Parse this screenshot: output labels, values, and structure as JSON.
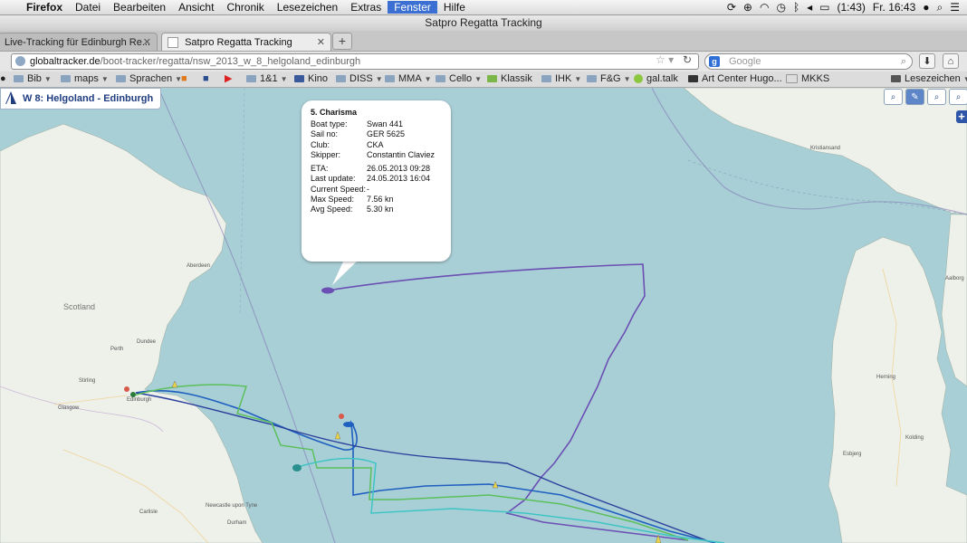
{
  "menubar": {
    "app": "Firefox",
    "items": [
      "Datei",
      "Bearbeiten",
      "Ansicht",
      "Chronik",
      "Lesezeichen",
      "Extras",
      "Fenster",
      "Hilfe"
    ],
    "battery": "(1:43)",
    "clock": "Fr. 16:43"
  },
  "window": {
    "title": "Satpro Regatta Tracking"
  },
  "tabs": [
    {
      "label": "Live-Tracking für Edinburgh Re..."
    },
    {
      "label": "Satpro Regatta Tracking"
    }
  ],
  "navbar": {
    "url_host": "globaltracker.de",
    "url_path": "/boot-tracker/regatta/nsw_2013_w_8_helgoland_edinburgh",
    "search_placeholder": "Google"
  },
  "bookmarks": [
    {
      "label": "Bib",
      "menu": true
    },
    {
      "label": "maps",
      "menu": true
    },
    {
      "label": "Sprachen",
      "menu": true
    },
    {
      "label": "1&1",
      "menu": true
    },
    {
      "label": "Kino",
      "menu": false
    },
    {
      "label": "DISS",
      "menu": true
    },
    {
      "label": "MMA",
      "menu": true
    },
    {
      "label": "Cello",
      "menu": true
    },
    {
      "label": "Klassik",
      "menu": false
    },
    {
      "label": "IHK",
      "menu": true
    },
    {
      "label": "F&G",
      "menu": true
    },
    {
      "label": "gal.talk",
      "menu": false
    },
    {
      "label": "Art Center Hugo...",
      "menu": false
    },
    {
      "label": "MKKS",
      "menu": false
    },
    {
      "label": "Lesezeichen",
      "menu": true
    }
  ],
  "map": {
    "race_name": "W 8: Helgoland - Edinburgh",
    "places": {
      "aberdeen": "Aberdeen",
      "scotland": "Scotland",
      "dundee": "Dundee",
      "perth": "Perth",
      "stirling": "Stirling",
      "glasgow": "Glasgow",
      "edinburgh": "Edinburgh",
      "carlisle": "Carlisle",
      "newcastle": "Newcastle upon Tyne",
      "durham": "Durham",
      "kristiansand": "Kristiansand",
      "aalborg": "Aalborg",
      "herning": "Herning",
      "esbjerg": "Esbjerg",
      "kolding": "Kolding"
    },
    "popup": {
      "title": "5. Charisma",
      "boat_type_label": "Boat type:",
      "boat_type": "Swan 441",
      "sail_no_label": "Sail no:",
      "sail_no": "GER 5625",
      "club_label": "Club:",
      "club": "CKA",
      "skipper_label": "Skipper:",
      "skipper": "Constantin Claviez",
      "eta_label": "ETA:",
      "eta": "26.05.2013 09:28",
      "last_update_label": "Last update:",
      "last_update": "24.05.2013 16:04",
      "current_speed_label": "Current Speed:",
      "current_speed": "-",
      "max_speed_label": "Max Speed:",
      "max_speed": "7.56 kn",
      "avg_speed_label": "Avg Speed:",
      "avg_speed": "5.30 kn"
    },
    "colors": {
      "sea": "#a9cfd6",
      "land": "#eef0ea",
      "track_purple": "#6b4fb3",
      "track_blue": "#1f5fbf",
      "track_green": "#5bbf5b",
      "track_cyan": "#3fc4c4"
    }
  }
}
